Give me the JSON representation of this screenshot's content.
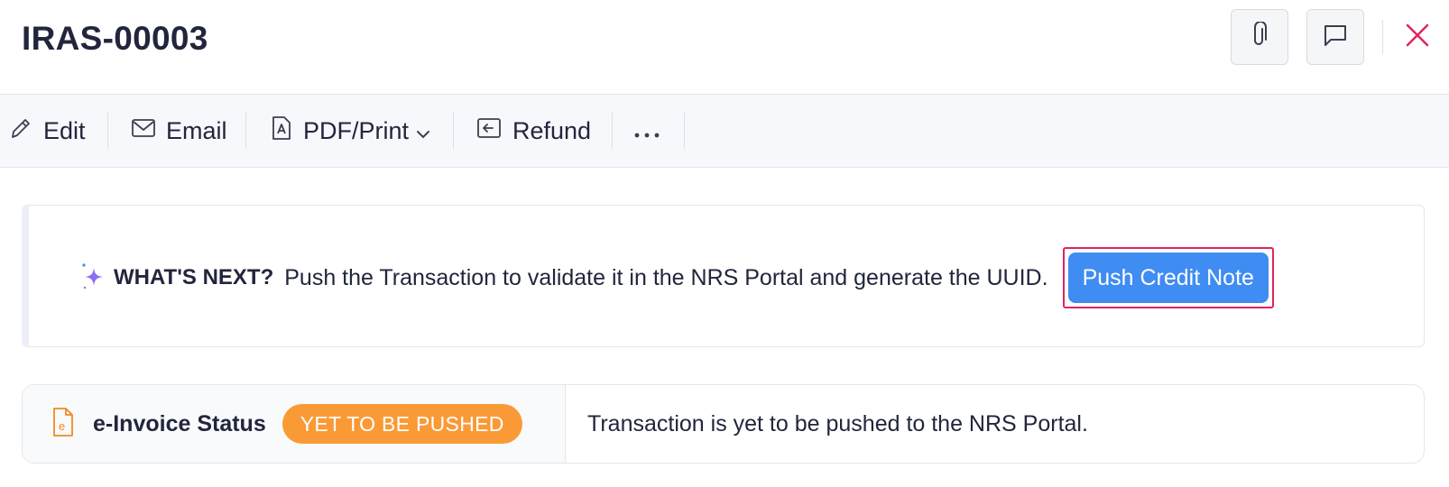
{
  "header": {
    "title": "IRAS-00003",
    "attach_icon": "paperclip-icon",
    "comment_icon": "chat-bubble-icon",
    "close_icon": "close-icon",
    "close_color": "#e0245e"
  },
  "toolbar": {
    "edit_label": "Edit",
    "email_label": "Email",
    "pdf_label": "PDF/Print",
    "refund_label": "Refund",
    "more_icon": "more-horizontal-icon"
  },
  "whats_next": {
    "label": "WHAT'S NEXT?",
    "text": "Push the Transaction to validate it in the NRS Portal and generate the UUID.",
    "button_label": "Push Credit Note",
    "icon": "sparkle-icon",
    "button_color": "#3f8cf2"
  },
  "einvoice": {
    "icon": "e-document-icon",
    "label": "e-Invoice Status",
    "badge": "YET TO BE PUSHED",
    "badge_color": "#f99a37",
    "message": "Transaction is yet to be pushed to the NRS Portal."
  }
}
